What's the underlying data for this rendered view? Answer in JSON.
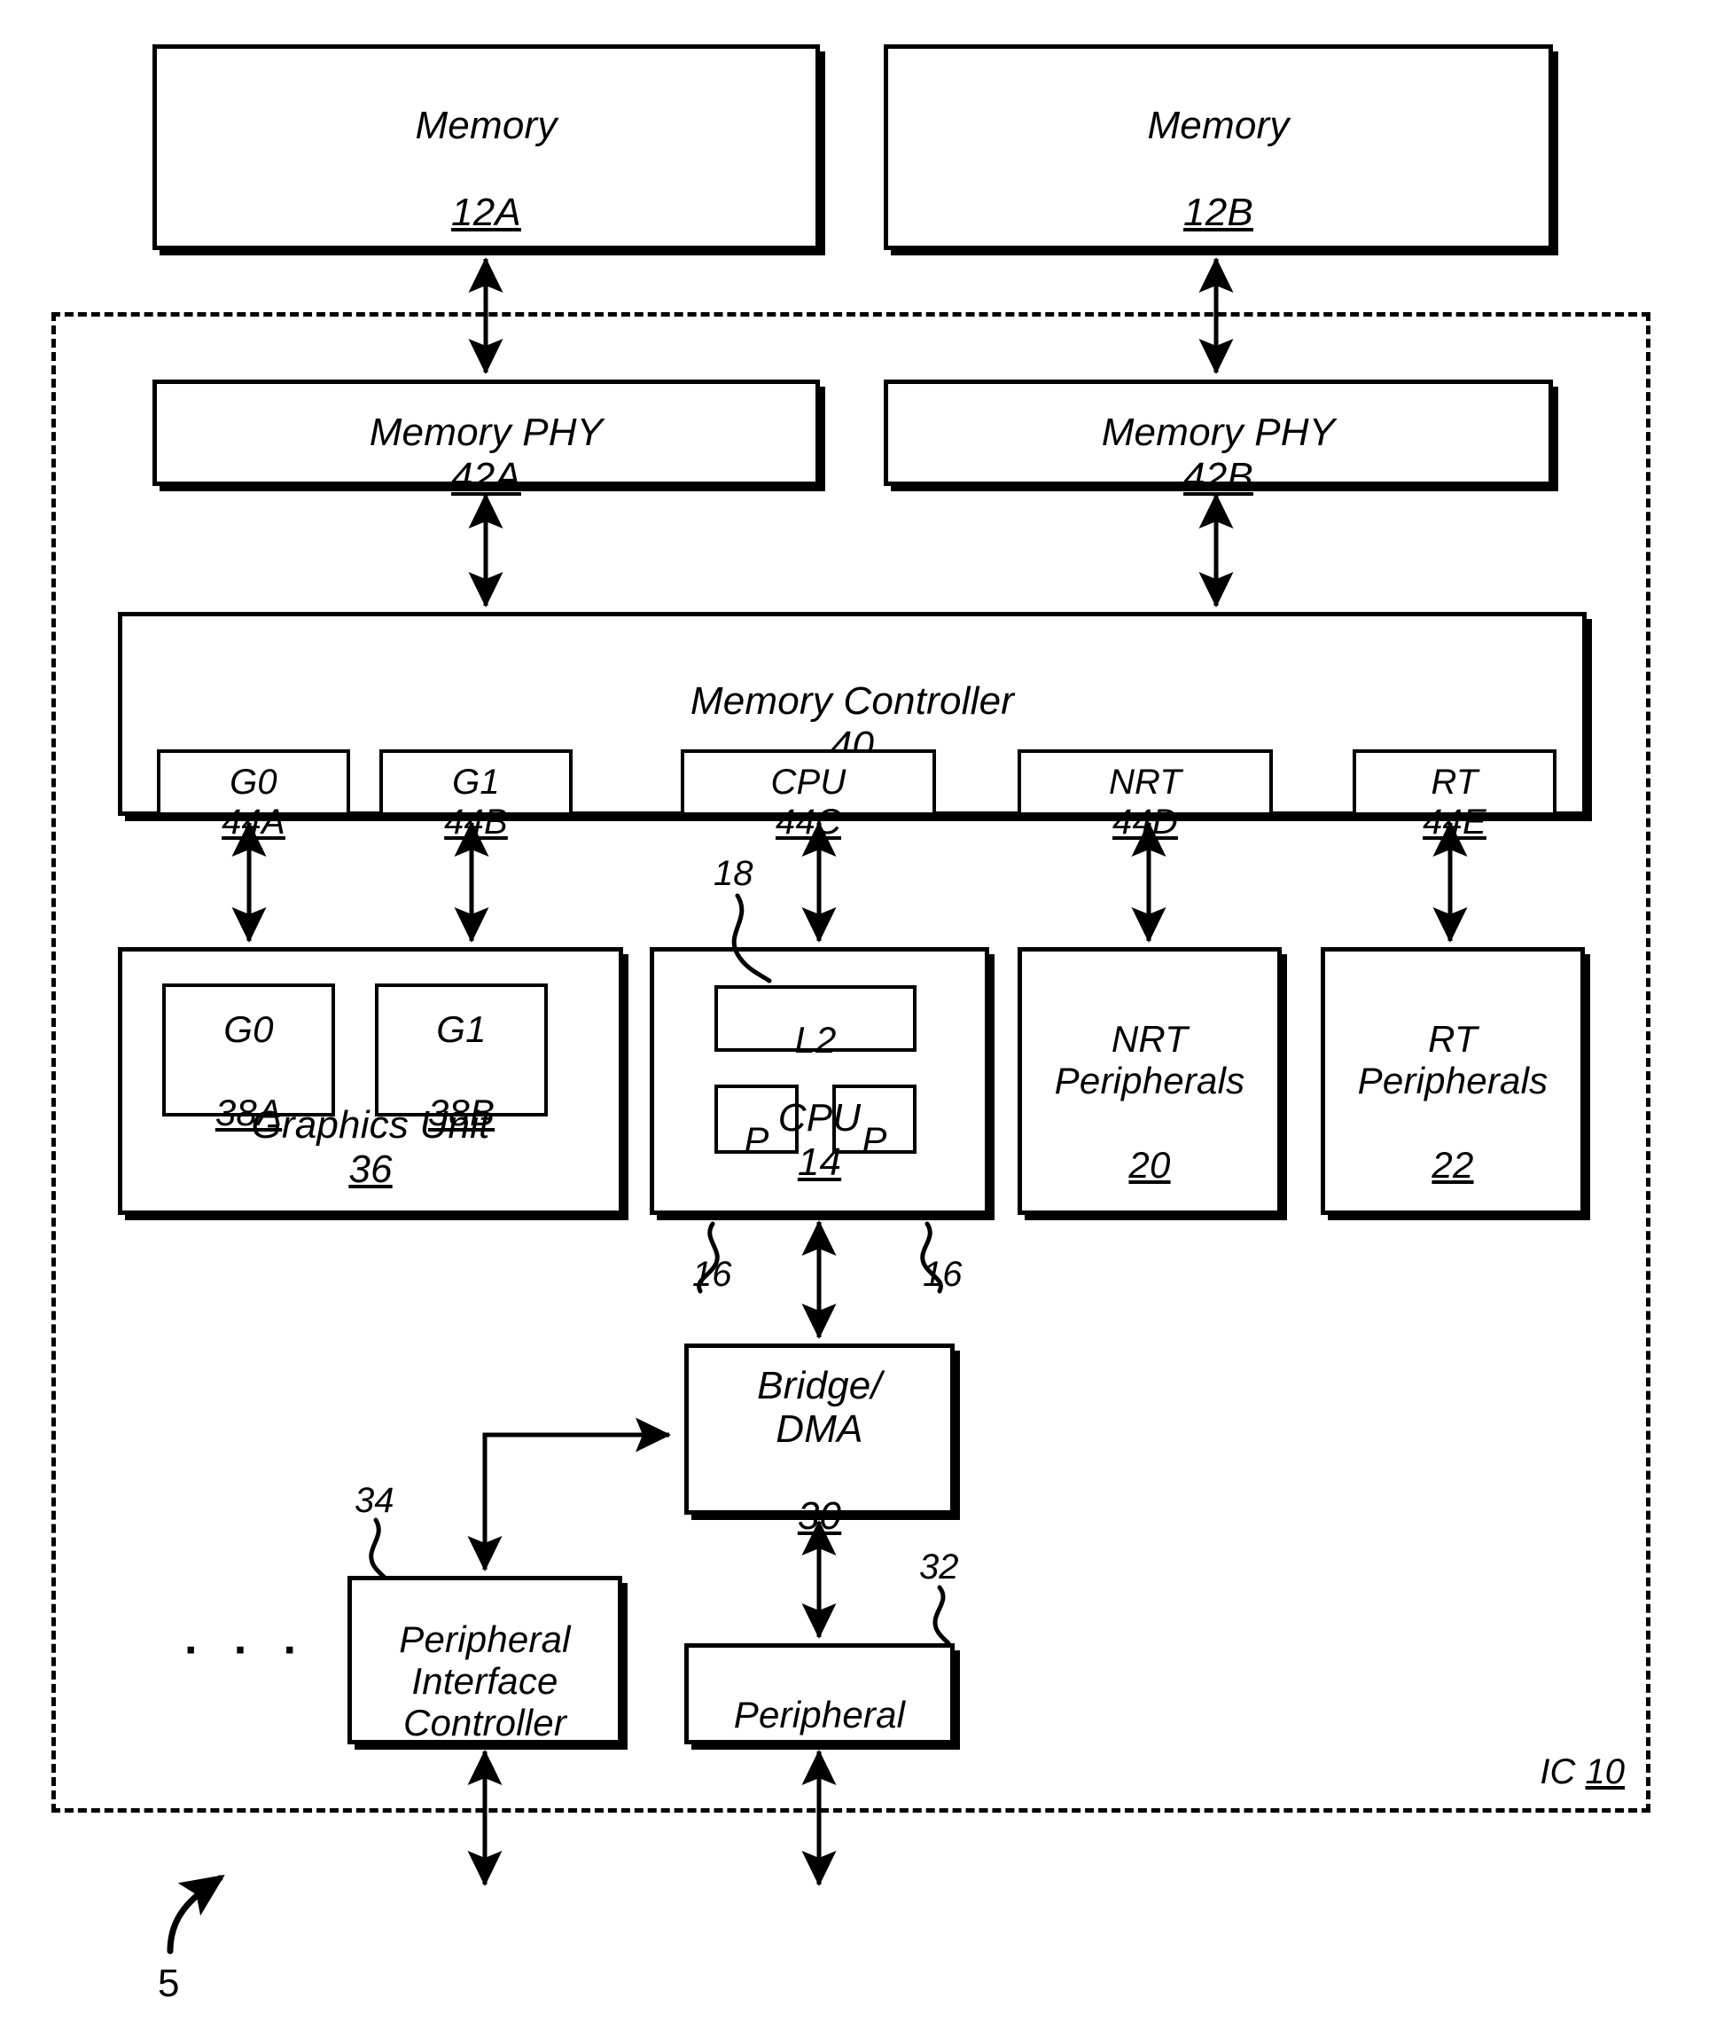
{
  "figure": {
    "figure_number": "5",
    "ic_label_text": "IC",
    "ic_label_number": "10",
    "ellipsis": "· · ·"
  },
  "blocks": {
    "memory_a": {
      "label": "Memory",
      "number": "12A"
    },
    "memory_b": {
      "label": "Memory",
      "number": "12B"
    },
    "phy_a": {
      "label": "Memory PHY",
      "number": "42A"
    },
    "phy_b": {
      "label": "Memory PHY",
      "number": "42B"
    },
    "memory_controller": {
      "label": "Memory Controller",
      "number": "40"
    },
    "graphics_unit": {
      "label": "Graphics Unit",
      "number": "36"
    },
    "g0_core": {
      "label": "G0",
      "number": "38A"
    },
    "g1_core": {
      "label": "G1",
      "number": "38B"
    },
    "cpu": {
      "label": "CPU",
      "number": "14"
    },
    "l2_cache": {
      "label": "L2",
      "number": ""
    },
    "processor_0": {
      "label": "P",
      "number": ""
    },
    "processor_1": {
      "label": "P",
      "number": ""
    },
    "nrt_peripherals": {
      "label": "NRT\nPeripherals",
      "number": "20"
    },
    "rt_peripherals": {
      "label": "RT\nPeripherals",
      "number": "22"
    },
    "bridge_dma": {
      "label": "Bridge/\nDMA",
      "number": "30"
    },
    "peripheral": {
      "label": "Peripheral",
      "number": ""
    },
    "peripheral_interface_controller": {
      "label": "Peripheral\nInterface\nController",
      "number": ""
    }
  },
  "ports": [
    {
      "label": "G0",
      "number": "44A"
    },
    {
      "label": "G1",
      "number": "44B"
    },
    {
      "label": "CPU",
      "number": "44C"
    },
    {
      "label": "NRT",
      "number": "44D"
    },
    {
      "label": "RT",
      "number": "44E"
    }
  ],
  "reference_numerals": {
    "l2_bus": "18",
    "proc_left": "16",
    "proc_right": "16",
    "pic_ref": "34",
    "peripheral_ref": "32"
  },
  "colors": {
    "ink": "#000000",
    "paper": "#ffffff"
  }
}
